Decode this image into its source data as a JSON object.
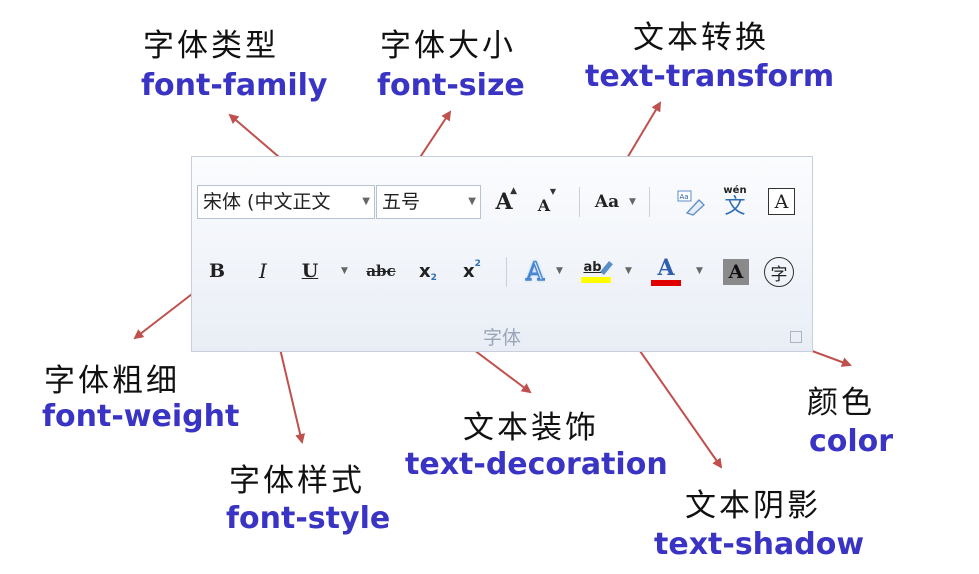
{
  "labels": {
    "font_family": {
      "zh": "字体类型",
      "en": "font-family"
    },
    "font_size": {
      "zh": "字体大小",
      "en": "font-size"
    },
    "text_transform": {
      "zh": "文本转换",
      "en": "text-transform"
    },
    "font_weight": {
      "zh": "字体粗细",
      "en": "font-weight"
    },
    "font_style": {
      "zh": "字体样式",
      "en": "font-style"
    },
    "text_decoration": {
      "zh": "文本装饰",
      "en": "text-decoration"
    },
    "text_shadow": {
      "zh": "文本阴影",
      "en": "text-shadow"
    },
    "color": {
      "zh": "颜色",
      "en": "color"
    }
  },
  "ribbon": {
    "font_name_value": "宋体 (中文正文",
    "font_size_value": "五号",
    "group_label": "字体",
    "buttons": {
      "bold": "B",
      "italic": "I",
      "underline": "U",
      "strikethrough": "abc",
      "subscript": "x",
      "subscript_mark": "2",
      "superscript": "x",
      "superscript_mark": "2",
      "grow_font": "A",
      "shrink_font": "A",
      "change_case": "Aa",
      "phonetic_top": "wén",
      "phonetic_bottom": "文",
      "char_border": "A",
      "text_effect": "A",
      "highlight": "ab",
      "font_color": "A",
      "char_shading": "A",
      "enclose_char": "字"
    }
  },
  "colors": {
    "label_en": "#3a34c4",
    "arrow": "#c0504d",
    "highlight_bar": "#ffff00",
    "font_color_bar": "#e00000"
  }
}
